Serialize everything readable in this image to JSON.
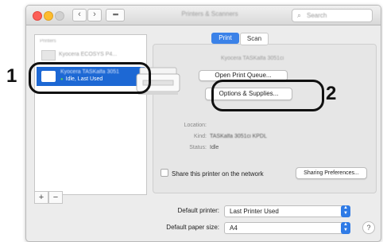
{
  "window": {
    "title": "Printers & Scanners",
    "search_placeholder": "Search",
    "search_icon": "search-icon"
  },
  "sidebar": {
    "header": "Printers",
    "items": [
      {
        "name": "Kyocera ECOSYS P4...",
        "status": ""
      },
      {
        "name": "Kyocera TASKalfa 3051",
        "status": "Idle, Last Used"
      }
    ],
    "add_label": "+",
    "remove_label": "−"
  },
  "tabs": [
    {
      "label": "Print"
    },
    {
      "label": "Scan"
    }
  ],
  "detail": {
    "printer_name": "Kyocera TASKalfa 3051ci",
    "open_queue_label": "Open Print Queue...",
    "options_supplies_label": "Options & Supplies...",
    "location_label": "Location:",
    "kind_label": "Kind:",
    "kind_value": "TASKalfa 3051ci KPDL",
    "status_label": "Status:",
    "status_value": "Idle",
    "share_label": "Share this printer on the network",
    "sharing_prefs_label": "Sharing Preferences..."
  },
  "footer": {
    "default_printer_label": "Default printer:",
    "default_printer_value": "Last Printer Used",
    "default_paper_label": "Default paper size:",
    "default_paper_value": "A4",
    "help_label": "?"
  },
  "callouts": [
    "1",
    "2"
  ],
  "colors": {
    "selection": "#1d68d4",
    "accent": "#3b82e8",
    "status_dot": "#57d05a"
  }
}
